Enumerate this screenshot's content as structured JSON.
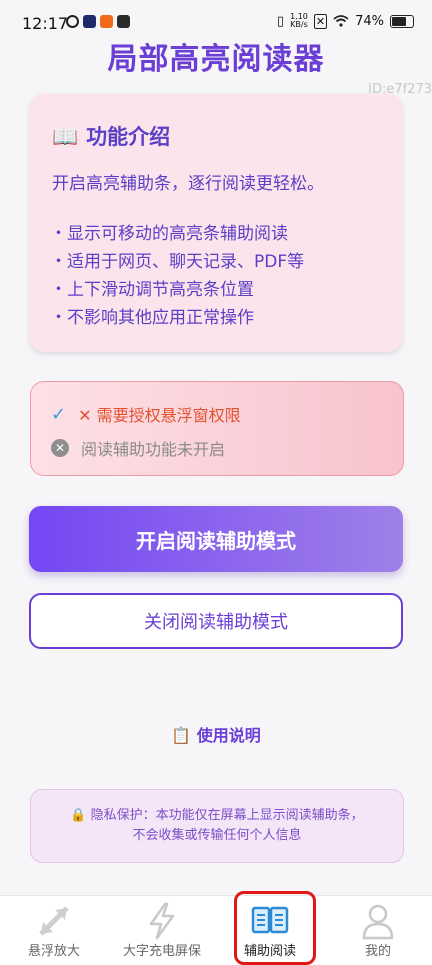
{
  "status_bar": {
    "time": "12:17",
    "net_speed_value": "1.10",
    "net_speed_unit": "KB/s",
    "battery": "74%"
  },
  "page": {
    "title": "局部高亮阅读器",
    "id_tag": "ID:e7f273"
  },
  "intro": {
    "icon": "book-icon",
    "title": "功能介绍",
    "description": "开启高亮辅助条，逐行阅读更轻松。",
    "features": [
      "・显示可移动的高亮条辅助阅读",
      "・适用于网页、聊天记录、PDF等",
      "・上下滑动调节高亮条位置",
      "・不影响其他应用正常操作"
    ]
  },
  "status": {
    "permission_text": "✕ 需要授权悬浮窗权限",
    "function_text": "阅读辅助功能未开启"
  },
  "actions": {
    "enable_label": "开启阅读辅助模式",
    "disable_label": "关闭阅读辅助模式",
    "help_label": "使用说明"
  },
  "privacy": {
    "line1": "🔒 隐私保护：本功能仅在屏幕上显示阅读辅助条，",
    "line2": "不会收集或传输任何个人信息"
  },
  "tabs": [
    {
      "label": "悬浮放大",
      "icon": "expand-arrows-icon"
    },
    {
      "label": "大字充电屏保",
      "icon": "lightning-icon"
    },
    {
      "label": "辅助阅读",
      "icon": "open-book-icon"
    },
    {
      "label": "我的",
      "icon": "person-icon"
    }
  ],
  "colors": {
    "accent": "#6b3fd6",
    "warning": "#e2522f",
    "highlight_outline": "#e01818"
  }
}
